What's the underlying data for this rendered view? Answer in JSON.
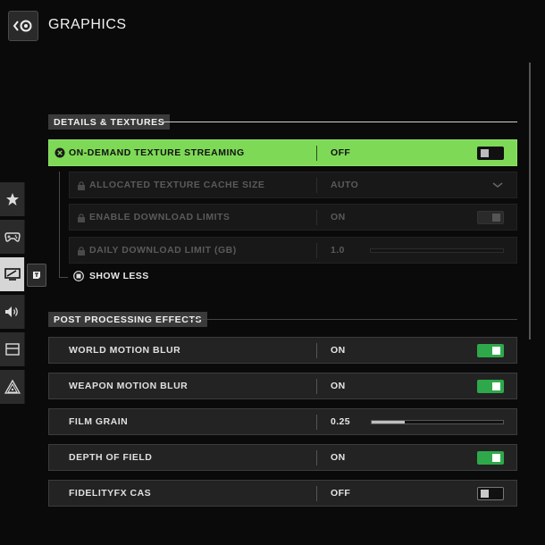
{
  "header": {
    "title": "GRAPHICS"
  },
  "sections": {
    "details": {
      "title": "DETAILS & TEXTURES"
    },
    "post": {
      "title": "POST PROCESSING EFFECTS"
    }
  },
  "rows": {
    "texture_streaming": {
      "label": "ON-DEMAND TEXTURE STREAMING",
      "value": "OFF",
      "toggle": "off"
    },
    "cache_size": {
      "label": "ALLOCATED TEXTURE CACHE SIZE",
      "value": "AUTO"
    },
    "download_limits": {
      "label": "ENABLE DOWNLOAD LIMITS",
      "value": "ON",
      "toggle": "on"
    },
    "daily_limit": {
      "label": "DAILY DOWNLOAD LIMIT (GB)",
      "value": "1.0",
      "slider": 0.0
    },
    "world_blur": {
      "label": "WORLD MOTION BLUR",
      "value": "ON",
      "toggle": "on"
    },
    "weapon_blur": {
      "label": "WEAPON MOTION BLUR",
      "value": "ON",
      "toggle": "on"
    },
    "film_grain": {
      "label": "FILM GRAIN",
      "value": "0.25",
      "slider": 0.25
    },
    "depth_of_field": {
      "label": "DEPTH OF FIELD",
      "value": "ON",
      "toggle": "on"
    },
    "fidelityfx": {
      "label": "FIDELITYFX CAS",
      "value": "OFF",
      "toggle": "off"
    }
  },
  "show_less": {
    "label": "SHOW LESS"
  },
  "rail": {
    "items": [
      {
        "icon": "star-icon"
      },
      {
        "icon": "gamepad-icon"
      },
      {
        "icon": "monitor-icon",
        "active": true
      },
      {
        "icon": "speaker-icon"
      },
      {
        "icon": "interface-icon"
      },
      {
        "icon": "network-icon"
      }
    ]
  },
  "colors": {
    "accent_green": "#7ed957",
    "toggle_on": "#2ea84a",
    "background": "#0a0a0a"
  }
}
